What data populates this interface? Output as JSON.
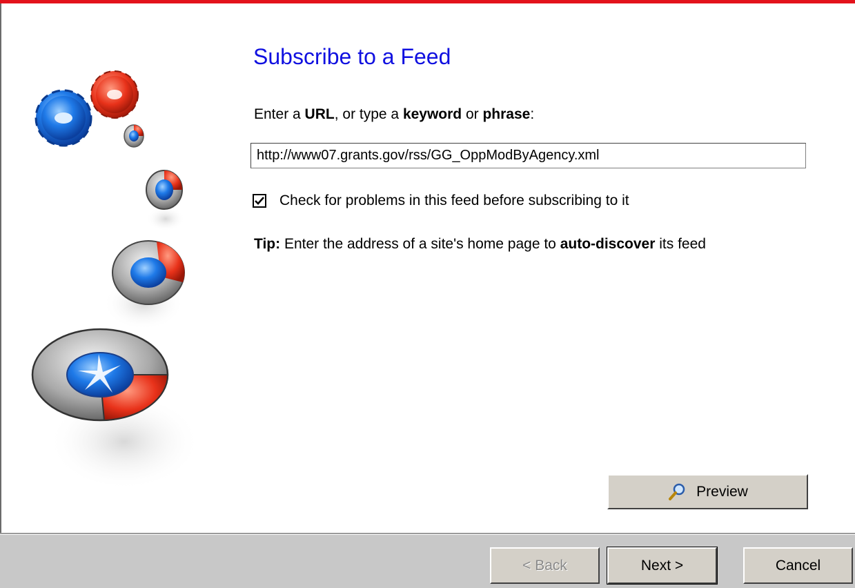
{
  "wizard": {
    "title": "Subscribe to a Feed",
    "prompt": {
      "part1": "Enter a ",
      "url_word": "URL",
      "part2": ", or type a ",
      "keyword_word": "keyword",
      "part3": " or ",
      "phrase_word": "phrase",
      "part4": ":"
    },
    "url_value": "http://www07.grants.gov/rss/GG_OppModByAgency.xml",
    "check_problems": {
      "label": "Check for problems in this feed before subscribing to it",
      "checked": true
    },
    "tip": {
      "lead": "Tip:",
      "part1": " Enter the address of a site's home page to ",
      "emph": "auto-discover",
      "part2": " its feed"
    },
    "preview_label": "Preview"
  },
  "footer": {
    "back_label": "< Back",
    "next_label": "Next >",
    "cancel_label": "Cancel"
  },
  "colors": {
    "title": "#1010e0",
    "top_border": "#e3121b",
    "footer_bg": "#c8c8c8"
  },
  "icons": [
    "gear-icon",
    "feed-disc-icon",
    "magnifier-icon",
    "checkmark-icon"
  ]
}
